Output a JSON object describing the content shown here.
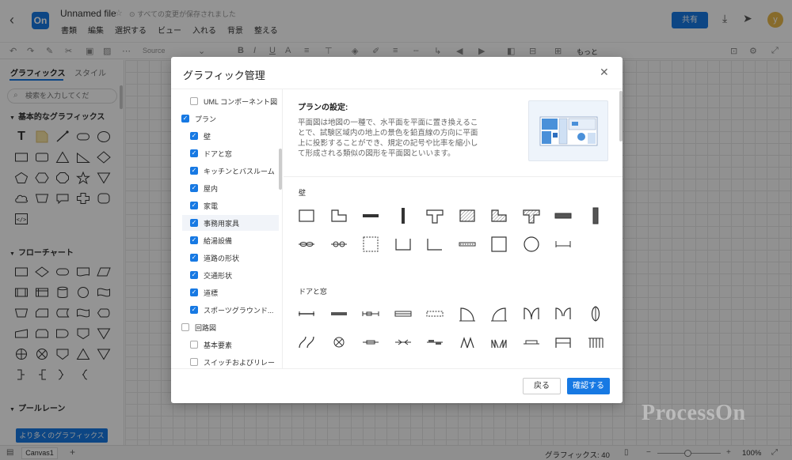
{
  "header": {
    "logo": "On",
    "file_title": "Unnamed file",
    "saved_status": "すべての変更が保存されました",
    "menu": [
      "書類",
      "編集",
      "選択する",
      "ビュー",
      "入れる",
      "背景",
      "整える"
    ],
    "share_label": "共有",
    "avatar_letter": "y"
  },
  "toolbar": {
    "font_name": "Source",
    "more_label": "もっと"
  },
  "left_panel": {
    "tab_graphics": "グラフィックス",
    "tab_style": "スタイル",
    "search_placeholder": "検索を入力してくだ",
    "section_basic": "基本的なグラフィックス",
    "section_flowchart": "フローチャート",
    "section_pool": "プールレーン",
    "more_graphics_label": "より多くのグラフィックス"
  },
  "dialog": {
    "title": "グラフィック管理",
    "tree": [
      {
        "label": "UML コンポーネント図",
        "checked": false,
        "level": 2
      },
      {
        "label": "プラン",
        "checked": true,
        "level": 1
      },
      {
        "label": "壁",
        "checked": true,
        "level": 2
      },
      {
        "label": "ドアと窓",
        "checked": true,
        "level": 2
      },
      {
        "label": "キッチンとバスルーム",
        "checked": true,
        "level": 2
      },
      {
        "label": "屋内",
        "checked": true,
        "level": 2
      },
      {
        "label": "家電",
        "checked": true,
        "level": 2
      },
      {
        "label": "事務用家具",
        "checked": true,
        "level": 2
      },
      {
        "label": "給湯設備",
        "checked": true,
        "level": 2
      },
      {
        "label": "道路の形状",
        "checked": true,
        "level": 2
      },
      {
        "label": "交通形状",
        "checked": true,
        "level": 2
      },
      {
        "label": "道標",
        "checked": true,
        "level": 2
      },
      {
        "label": "スポーツグラウンド...",
        "checked": true,
        "level": 2
      },
      {
        "label": "回路図",
        "checked": false,
        "level": 1
      },
      {
        "label": "基本要素",
        "checked": false,
        "level": 2
      },
      {
        "label": "スイッチおよびリレー",
        "checked": false,
        "level": 2
      }
    ],
    "plan_title": "プランの設定:",
    "plan_desc": "平面図は地図の一種で、水平面を平面に置き換えることで、試験区域内の地上の景色を鉛直線の方向に平面上に投影することができ、規定の記号や比率を縮小して形成される類似の図形を平面図といいます。",
    "group_wall": "壁",
    "group_door_window": "ドアと窓",
    "back_label": "戻る",
    "confirm_label": "確認する"
  },
  "statusbar": {
    "page_tab": "Canvas1",
    "graphics_count": "グラフィックス: 40",
    "zoom": "100%"
  },
  "watermark": "ProcessOn",
  "colors": {
    "accent": "#1779e3",
    "overlay": "rgba(0,0,0,0.42)"
  }
}
